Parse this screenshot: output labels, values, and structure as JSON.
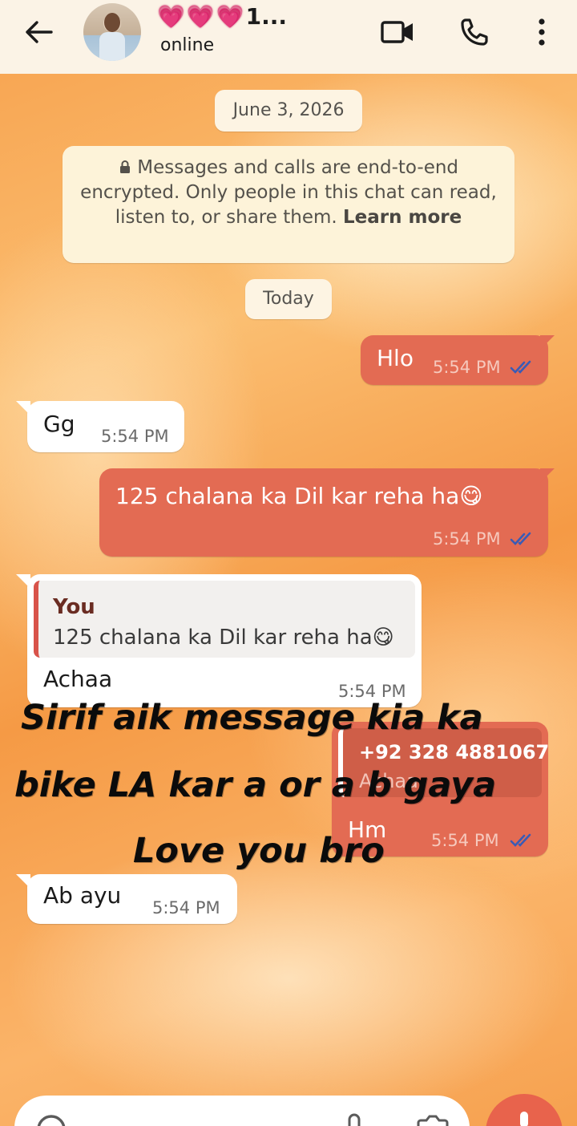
{
  "header": {
    "contact_hearts": "💗💗💗",
    "contact_name_suffix": "1...",
    "status": "online"
  },
  "system": {
    "date_pill": "June 3, 2026",
    "encryption_notice": "Messages and calls are end-to-end encrypted. Only people in this chat can read, listen to, or share them.",
    "learn_more": "Learn more",
    "today_pill": "Today"
  },
  "messages": [
    {
      "direction": "outgoing",
      "text": "Hlo",
      "time": "5:54 PM",
      "status": "read"
    },
    {
      "direction": "incoming",
      "text": "Gg",
      "time": "5:54 PM"
    },
    {
      "direction": "outgoing",
      "text": "125 chalana ka Dil kar reha ha😋",
      "time": "5:54 PM",
      "status": "read"
    },
    {
      "direction": "incoming",
      "quote_author": "You",
      "quote_text": "125 chalana ka Dil kar reha ha😋",
      "text": "Achaa",
      "time": "5:54 PM"
    },
    {
      "direction": "outgoing",
      "quote_author": "+92 328 4881067",
      "quote_text": "Achaa",
      "text": "Hm",
      "time": "5:54 PM",
      "status": "read"
    },
    {
      "direction": "incoming",
      "text": "Ab ayu",
      "time": "5:54 PM"
    }
  ],
  "overlay": {
    "line1": "Sirif aik message kia ka",
    "line2": "bike LA kar a or a b gaya",
    "line3": "Love you bro"
  },
  "colors": {
    "outgoing_bubble": "#e36b53",
    "incoming_bubble": "#ffffff",
    "header_bg": "#fbf3e6",
    "read_ticks": "#3b5bb5"
  }
}
